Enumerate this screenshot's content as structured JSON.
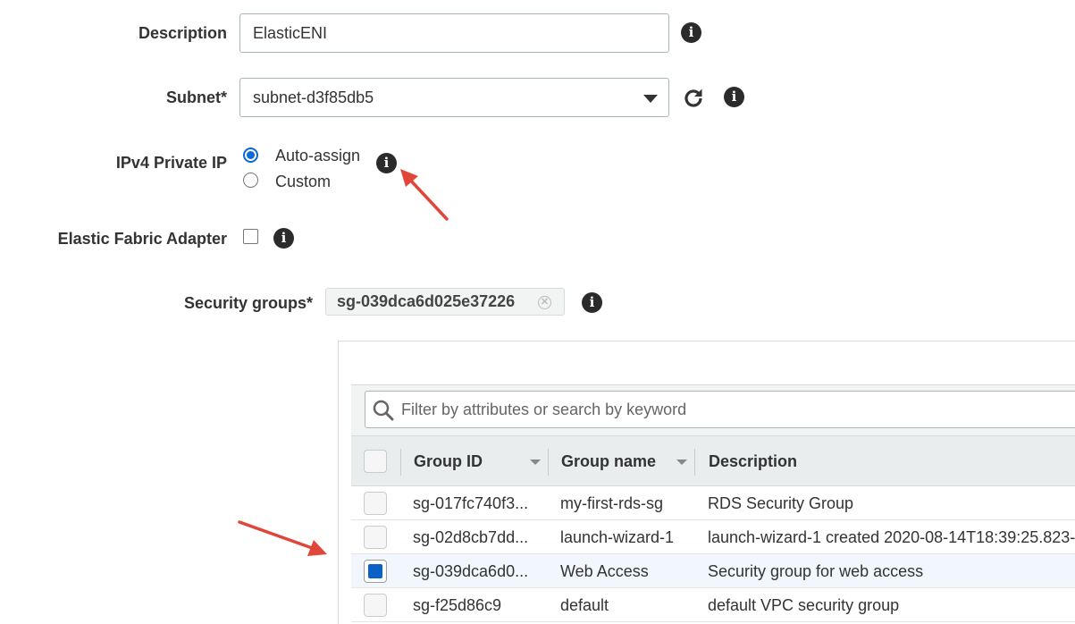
{
  "form": {
    "description_label": "Description",
    "description_value": "ElasticENI",
    "subnet_label": "Subnet*",
    "subnet_value": "subnet-d3f85db5",
    "ipv4_label": "IPv4 Private IP",
    "ipv4_options": [
      "Auto-assign",
      "Custom"
    ],
    "ipv4_selected": "Auto-assign",
    "efa_label": "Elastic Fabric Adapter",
    "security_groups_label": "Security groups*",
    "security_group_token": "sg-039dca6d025e37226"
  },
  "table": {
    "filter_placeholder": "Filter by attributes or search by keyword",
    "columns": [
      "Group ID",
      "Group name",
      "Description"
    ],
    "rows": [
      {
        "group_id": "sg-017fc740f3...",
        "group_name": "my-first-rds-sg",
        "description": "RDS Security Group",
        "selected": false
      },
      {
        "group_id": "sg-02d8cb7dd...",
        "group_name": "launch-wizard-1",
        "description": "launch-wizard-1 created 2020-08-14T18:39:25.823-",
        "selected": false
      },
      {
        "group_id": "sg-039dca6d0...",
        "group_name": "Web Access",
        "description": "Security group for web access",
        "selected": true
      },
      {
        "group_id": "sg-f25d86c9",
        "group_name": "default",
        "description": "default VPC security group",
        "selected": false
      }
    ]
  },
  "icons": {
    "info": "info-icon",
    "refresh": "refresh-icon",
    "search": "search-icon",
    "remove": "remove-token-icon"
  },
  "colors": {
    "accent": "#0b6ad8",
    "annotation_arrow": "#e0473a"
  }
}
